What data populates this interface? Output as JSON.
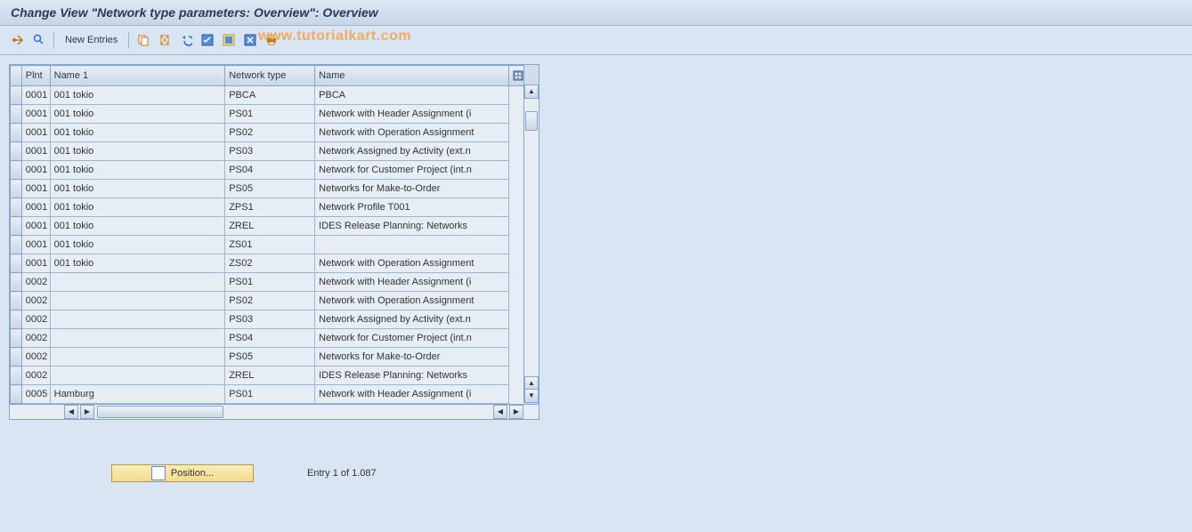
{
  "title": "Change View \"Network type parameters: Overview\": Overview",
  "toolbar": {
    "new_entries": "New Entries"
  },
  "watermark": "www.tutorialkart.com",
  "columns": {
    "plnt": "Plnt",
    "name1": "Name 1",
    "ntype": "Network type",
    "name": "Name"
  },
  "rows": [
    {
      "plnt": "0001",
      "name1": "001 tokio",
      "ntype": "PBCA",
      "name": "PBCA"
    },
    {
      "plnt": "0001",
      "name1": "001 tokio",
      "ntype": "PS01",
      "name": "Network with Header Assignment (i"
    },
    {
      "plnt": "0001",
      "name1": "001 tokio",
      "ntype": "PS02",
      "name": "Network with Operation Assignment"
    },
    {
      "plnt": "0001",
      "name1": "001 tokio",
      "ntype": "PS03",
      "name": "Network Assigned by Activity (ext.n"
    },
    {
      "plnt": "0001",
      "name1": "001 tokio",
      "ntype": "PS04",
      "name": "Network for Customer Project (int.n"
    },
    {
      "plnt": "0001",
      "name1": "001 tokio",
      "ntype": "PS05",
      "name": "Networks for Make-to-Order"
    },
    {
      "plnt": "0001",
      "name1": "001 tokio",
      "ntype": "ZPS1",
      "name": "Network Profile T001"
    },
    {
      "plnt": "0001",
      "name1": "001 tokio",
      "ntype": "ZREL",
      "name": "IDES Release Planning: Networks"
    },
    {
      "plnt": "0001",
      "name1": "001 tokio",
      "ntype": "ZS01",
      "name": ""
    },
    {
      "plnt": "0001",
      "name1": "001 tokio",
      "ntype": "ZS02",
      "name": "Network with Operation Assignment"
    },
    {
      "plnt": "0002",
      "name1": "",
      "ntype": "PS01",
      "name": "Network with Header Assignment (i"
    },
    {
      "plnt": "0002",
      "name1": "",
      "ntype": "PS02",
      "name": "Network with Operation Assignment"
    },
    {
      "plnt": "0002",
      "name1": "",
      "ntype": "PS03",
      "name": "Network Assigned by Activity (ext.n"
    },
    {
      "plnt": "0002",
      "name1": "",
      "ntype": "PS04",
      "name": "Network for Customer Project (int.n"
    },
    {
      "plnt": "0002",
      "name1": "",
      "ntype": "PS05",
      "name": "Networks for Make-to-Order"
    },
    {
      "plnt": "0002",
      "name1": "",
      "ntype": "ZREL",
      "name": "IDES Release Planning: Networks"
    },
    {
      "plnt": "0005",
      "name1": "Hamburg",
      "ntype": "PS01",
      "name": "Network with Header Assignment (i"
    }
  ],
  "position_button": "Position...",
  "entry_status": "Entry 1 of 1.087"
}
